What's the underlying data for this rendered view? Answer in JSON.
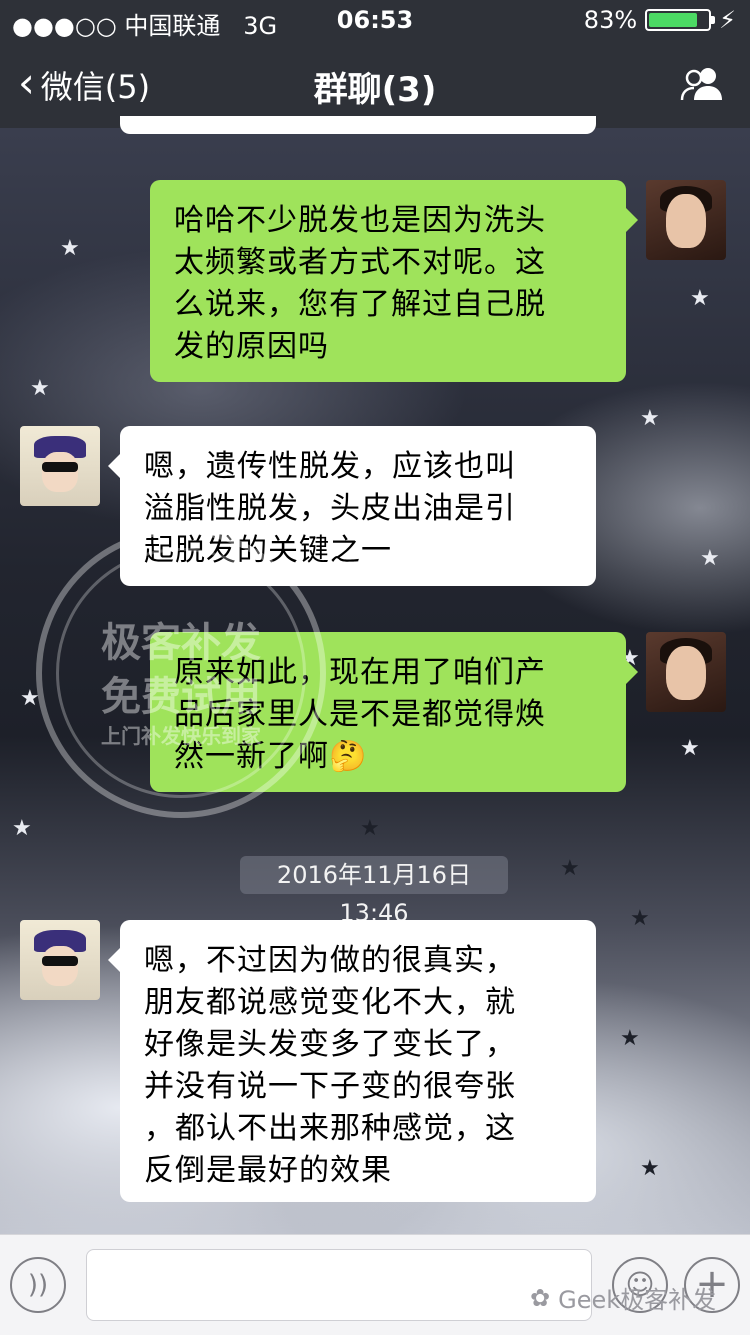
{
  "status_bar": {
    "carrier": "●●●○○ 中国联通",
    "network": "3G",
    "time": "06:53",
    "battery_text": "83%",
    "battery_level": 0.83,
    "battery_color": "#4cd964",
    "charging_icon": "bolt-icon"
  },
  "nav": {
    "back_label": "微信(5)",
    "title": "群聊(3)",
    "right_icon": "group-members-icon"
  },
  "messages": [
    {
      "sender": "me",
      "lines": [
        "哈哈不少脱发也是因为洗头",
        "太频繁或者方式不对呢。这",
        "么说来，您有了解过自己脱",
        "发的原因吗"
      ]
    },
    {
      "sender": "other",
      "lines": [
        "嗯，遗传性脱发，应该也叫",
        "溢脂性脱发，头皮出油是引",
        "起脱发的关键之一"
      ]
    },
    {
      "sender": "me",
      "lines": [
        "原来如此，现在用了咱们产",
        "品后家里人是不是都觉得焕",
        "然一新了啊"
      ],
      "emoji": "🤔"
    },
    {
      "sender": "other",
      "lines": [
        "嗯，不过因为做的很真实，",
        "朋友都说感觉变化不大，就",
        "好像是头发变多了变长了，",
        "并没有说一下子变的很夸张",
        "，都认不出来那种感觉，这",
        "反倒是最好的效果"
      ]
    }
  ],
  "time_divider": "2016年11月16日 13:46",
  "watermark": {
    "line1": "极客补发",
    "line2": "免费试用",
    "line3": "上门补发快乐到家",
    "footer": "Geek极客补发"
  },
  "colors": {
    "bubble_me": "#9fe35b",
    "bubble_other": "#ffffff",
    "nav_bg": "#2e3138"
  }
}
